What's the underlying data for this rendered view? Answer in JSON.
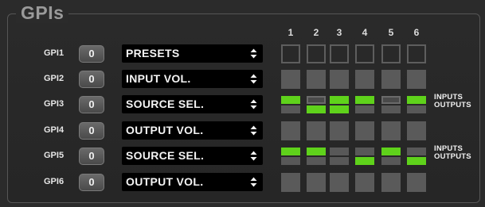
{
  "panel_title": "GPIs",
  "columns": [
    "1",
    "2",
    "3",
    "4",
    "5",
    "6"
  ],
  "io_labels": {
    "inputs": "INPUTS",
    "outputs": "OUTPUTS"
  },
  "colors": {
    "active": "#5fd21b",
    "inactive": "#585858"
  },
  "rows": [
    {
      "label": "GPI1",
      "number": "0",
      "function": "PRESETS",
      "cells": [
        "outline",
        "outline",
        "outline",
        "outline",
        "outline",
        "outline"
      ],
      "io": false
    },
    {
      "label": "GPI2",
      "number": "0",
      "function": "INPUT VOL.",
      "cells": [
        "solid",
        "solid",
        "solid",
        "solid",
        "solid",
        "solid"
      ],
      "io": false
    },
    {
      "label": "GPI3",
      "number": "0",
      "function": "SOURCE SEL.",
      "cells": [
        {
          "in": "on",
          "out": "off"
        },
        {
          "in": "dim",
          "out": "on"
        },
        {
          "in": "on",
          "out": "on"
        },
        {
          "in": "on",
          "out": "off"
        },
        {
          "in": "dim",
          "out": "off"
        },
        {
          "in": "on",
          "out": "off"
        }
      ],
      "io": true
    },
    {
      "label": "GPI4",
      "number": "0",
      "function": "OUTPUT VOL.",
      "cells": [
        "solid",
        "solid",
        "solid",
        "solid",
        "solid",
        "solid"
      ],
      "io": false
    },
    {
      "label": "GPI5",
      "number": "0",
      "function": "SOURCE SEL.",
      "cells": [
        {
          "in": "on",
          "out": "off"
        },
        {
          "in": "on",
          "out": "off"
        },
        {
          "in": "off",
          "out": "off"
        },
        {
          "in": "off",
          "out": "on"
        },
        {
          "in": "on",
          "out": "off"
        },
        {
          "in": "off",
          "out": "on"
        }
      ],
      "io": true
    },
    {
      "label": "GPI6",
      "number": "0",
      "function": "OUTPUT VOL.",
      "cells": [
        "solid",
        "solid",
        "solid",
        "solid",
        "solid",
        "solid"
      ],
      "io": false
    }
  ]
}
